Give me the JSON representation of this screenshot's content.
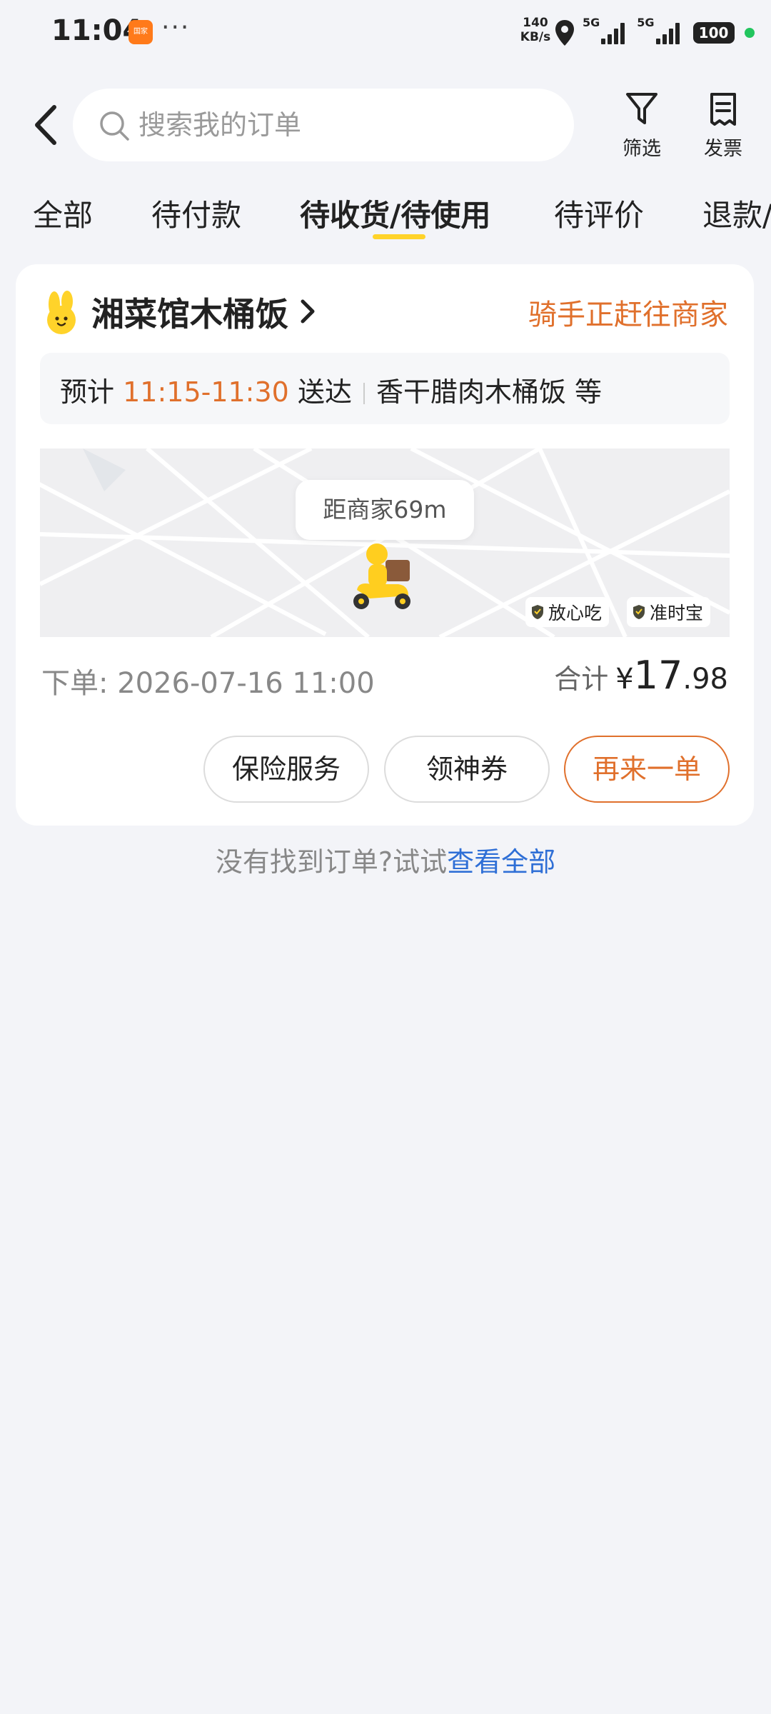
{
  "status_bar": {
    "time": "11:04",
    "app_icon_text": "国家",
    "more": "···",
    "speed_value": "140",
    "speed_unit": "KB/s",
    "network_1": "5G",
    "network_2": "5G",
    "battery": "100"
  },
  "header": {
    "search_placeholder": "搜索我的订单",
    "filter_label": "筛选",
    "invoice_label": "发票"
  },
  "tabs": [
    {
      "label": "全部"
    },
    {
      "label": "待付款"
    },
    {
      "label": "待收货/待使用",
      "active": true
    },
    {
      "label": "待评价"
    },
    {
      "label": "退款/"
    }
  ],
  "order": {
    "shop_name": "湘菜馆木桶饭",
    "status": "骑手正赶往商家",
    "eta_prefix": "预计",
    "eta_time": "11:15-11:30",
    "eta_suffix": "送达",
    "items_summary": "香干腊肉木桶饭 等",
    "map_distance": "距商家69m",
    "badges": [
      "放心吃",
      "准时宝"
    ],
    "order_time_label": "下单:",
    "order_time": "2026-07-16 11:00",
    "total_label": "合计",
    "currency": "¥",
    "total_int": "17",
    "total_dec": ".98",
    "buttons": {
      "insurance": "保险服务",
      "coupon": "领神券",
      "reorder": "再来一单"
    }
  },
  "footer": {
    "hint": "没有找到订单?试试",
    "link": "查看全部"
  },
  "colors": {
    "accent_orange": "#e0702c",
    "tab_underline": "#ffd32a",
    "link_blue": "#2f6fd6",
    "background": "#f3f4f8"
  }
}
